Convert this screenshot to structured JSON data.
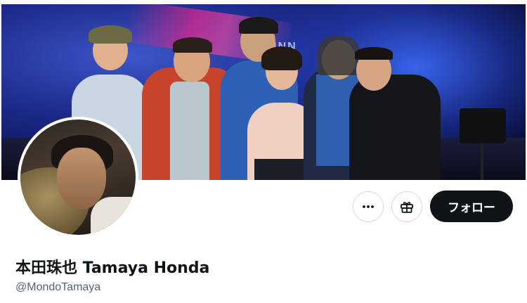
{
  "banner": {
    "description_label": "header-photo",
    "sign_text": "NNN"
  },
  "profile": {
    "display_name": "本田珠也 Tamaya Honda",
    "handle": "@MondoTamaya"
  },
  "actions": {
    "more_icon": "more-horizontal-icon",
    "gift_icon": "gift-icon",
    "follow_label": "フォロー"
  },
  "colors": {
    "follow_bg": "#0f1419",
    "handle_text": "#536471",
    "border": "#cfd9de"
  }
}
